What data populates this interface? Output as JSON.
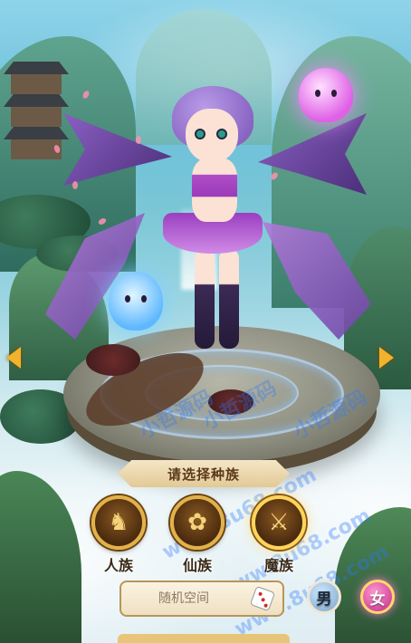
{
  "banner": {
    "title": "请选择种族"
  },
  "races": [
    {
      "id": "human",
      "label": "人族",
      "icon": "horse-emblem-icon",
      "glyph": "♞",
      "selected": false
    },
    {
      "id": "immortal",
      "label": "仙族",
      "icon": "flower-emblem-icon",
      "glyph": "✿",
      "selected": false
    },
    {
      "id": "demon",
      "label": "魔族",
      "icon": "demon-emblem-icon",
      "glyph": "⚔",
      "selected": true
    }
  ],
  "name_field": {
    "placeholder": "随机空间",
    "value": ""
  },
  "gender": {
    "male_label": "男",
    "female_label": "女",
    "selected": "female"
  },
  "navigation": {
    "prev_icon": "arrow-left-icon",
    "next_icon": "arrow-right-icon"
  },
  "colors": {
    "accent": "#f3b22b",
    "female": "#c2288a",
    "banner_text": "#5a3a1c"
  },
  "watermarks": [
    "小哲源码",
    "小哲源码",
    "小哲源码",
    "www.8u68.com",
    "www.8u68.com",
    "www.8u68.com"
  ]
}
